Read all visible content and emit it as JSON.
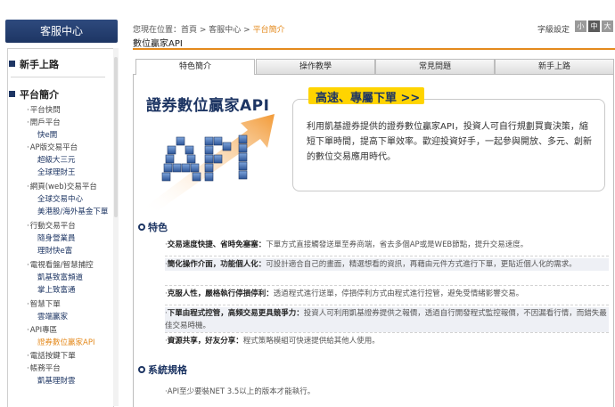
{
  "sidebar": {
    "header": "客服中心",
    "sections": [
      {
        "title": "新手上路"
      },
      {
        "title": "平台簡介"
      }
    ],
    "items": [
      {
        "label": "平台快問",
        "level": 1
      },
      {
        "label": "開戶平台",
        "level": 1
      },
      {
        "label": "快e開",
        "level": 2
      },
      {
        "label": "AP版交易平台",
        "level": 1
      },
      {
        "label": "超級大三元",
        "level": 2
      },
      {
        "label": "全球理財王",
        "level": 2
      },
      {
        "label": "網頁(web)交易平台",
        "level": 1
      },
      {
        "label": "全球交易中心",
        "level": 2
      },
      {
        "label": "美港股/海外基金下單",
        "level": 2
      },
      {
        "label": "行動交易平台",
        "level": 1
      },
      {
        "label": "隨身營業員",
        "level": 2
      },
      {
        "label": "理財快e富",
        "level": 2
      },
      {
        "label": "電視看盤/智慧捕控",
        "level": 1
      },
      {
        "label": "凱基致富頻道",
        "level": 2
      },
      {
        "label": "掌上致富通",
        "level": 2
      },
      {
        "label": "智慧下單",
        "level": 1
      },
      {
        "label": "雲端贏家",
        "level": 2
      },
      {
        "label": "API專區",
        "level": 1
      },
      {
        "label": "證券數位贏家API",
        "level": 2,
        "active": true
      },
      {
        "label": "電話按鍵下單",
        "level": 1
      },
      {
        "label": "帳務平台",
        "level": 1
      },
      {
        "label": "凱基理財雲",
        "level": 2
      }
    ]
  },
  "breadcrumb": {
    "prefix": "您現在位置：",
    "items": [
      "首頁",
      "客服中心"
    ],
    "current": "平台簡介",
    "sep": " > "
  },
  "page_title": "數位贏家API",
  "font_size": {
    "label": "字級設定",
    "options": [
      "小",
      "中",
      "大"
    ],
    "selected": "中"
  },
  "tabs": [
    "特色簡介",
    "操作教學",
    "常見問題",
    "新手上路"
  ],
  "active_tab": "特色簡介",
  "banner": {
    "title": "證券數位贏家API",
    "slogan": "高速、專屬下單 >>",
    "graphic_text": "API",
    "text": "利用凱基證券提供的證券數位贏家API，投資人可自行規劃買賣決策，縮短下單時間，提高下單效率。歡迎投資好手，一起參與開放、多元、創新的數位交易應用時代。"
  },
  "features": {
    "title": "特色",
    "rows": [
      {
        "head": "交易速度快捷、省時免塞塞：",
        "body": "下單方式直接觸發送單至券商端，省去多個AP或是WEB節點，提升交易速度。"
      },
      {
        "head": "簡化操作介面，功能個人化：",
        "body": "可設計適合自己的畫面，精選想看的資訊，再藉由元件方式進行下單，更貼近個人化的需求。"
      },
      {
        "head": "克服人性，嚴格執行停損停利：",
        "body": "透過程式進行送單，停損停利方式由程式進行控管，避免受情緒影響交易。"
      },
      {
        "head": "下單由程式控管，高頻交易更具競爭力：",
        "body": "投資人可利用凱基證券提供之報價，透過自行開發程式監控報價，不因漏看行情，而錯失最佳交易時機。"
      },
      {
        "head": "資源共享，好友分享：",
        "body": "程式策略模組可快速提供給其他人使用。"
      }
    ]
  },
  "specs": {
    "title": "系統規格",
    "rows": [
      "API至少要裝NET 3.5以上的版本才能執行。"
    ]
  },
  "colors": {
    "accent": "#e48a1d",
    "brand": "#1d3563",
    "slogan_bg": "#ffd400"
  }
}
